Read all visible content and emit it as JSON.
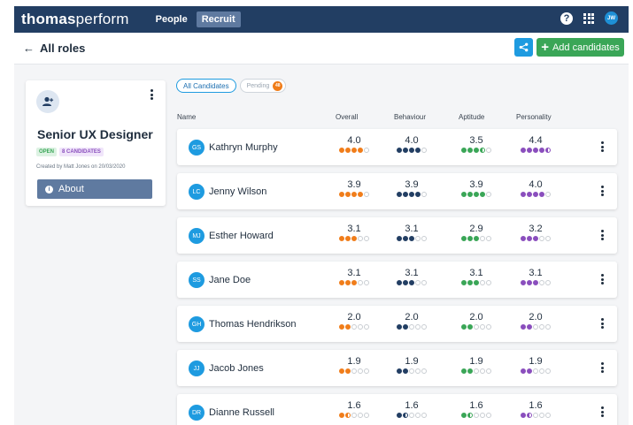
{
  "brand": {
    "bold": "thomas",
    "light": "perform"
  },
  "nav": {
    "items": [
      "People",
      "Recruit"
    ],
    "active": "Recruit"
  },
  "user": {
    "initials": "JW"
  },
  "subheader": {
    "back_label": "All roles",
    "add_label": "Add candidates"
  },
  "role": {
    "title": "Senior UX Designer",
    "status": "OPEN",
    "candidate_count": "8 CANDIDATES",
    "created": "Created by Matt Jones on 20/03/2020",
    "about_label": "About"
  },
  "filters": {
    "all_label": "All Candidates",
    "pending_label": "Pending",
    "pending_count": "48"
  },
  "columns": {
    "name": "Name",
    "overall": "Overall",
    "behaviour": "Behaviour",
    "aptitude": "Aptitude",
    "personality": "Personality"
  },
  "colors": {
    "overall": "#f07d1a",
    "behaviour": "#223e63",
    "aptitude": "#3aa657",
    "personality": "#8a4ebd",
    "avatar": "#1e9be0",
    "add_button": "#3aa657",
    "share_button": "#1e9be0"
  },
  "candidates": [
    {
      "initials": "GS",
      "name": "Kathryn Murphy",
      "overall": "4.0",
      "behaviour": "4.0",
      "aptitude": "3.5",
      "personality": "4.4"
    },
    {
      "initials": "LC",
      "name": "Jenny Wilson",
      "overall": "3.9",
      "behaviour": "3.9",
      "aptitude": "3.9",
      "personality": "4.0"
    },
    {
      "initials": "MJ",
      "name": "Esther Howard",
      "overall": "3.1",
      "behaviour": "3.1",
      "aptitude": "2.9",
      "personality": "3.2"
    },
    {
      "initials": "SS",
      "name": "Jane Doe",
      "overall": "3.1",
      "behaviour": "3.1",
      "aptitude": "3.1",
      "personality": "3.1"
    },
    {
      "initials": "GH",
      "name": "Thomas Hendrikson",
      "overall": "2.0",
      "behaviour": "2.0",
      "aptitude": "2.0",
      "personality": "2.0"
    },
    {
      "initials": "JJ",
      "name": "Jacob Jones",
      "overall": "1.9",
      "behaviour": "1.9",
      "aptitude": "1.9",
      "personality": "1.9"
    },
    {
      "initials": "DR",
      "name": "Dianne Russell",
      "overall": "1.6",
      "behaviour": "1.6",
      "aptitude": "1.6",
      "personality": "1.6"
    }
  ]
}
